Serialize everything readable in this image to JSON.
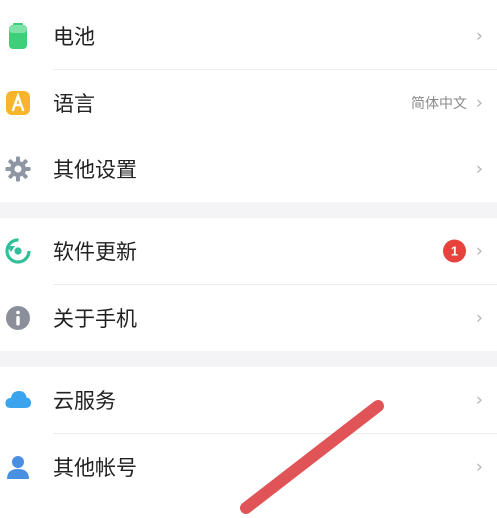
{
  "settings": {
    "group1": [
      {
        "label": "电池",
        "icon": "battery-icon"
      },
      {
        "label": "语言",
        "icon": "language-icon",
        "value": "简体中文"
      },
      {
        "label": "其他设置",
        "icon": "gear-icon"
      }
    ],
    "group2": [
      {
        "label": "软件更新",
        "icon": "update-icon",
        "badge": "1"
      },
      {
        "label": "关于手机",
        "icon": "info-icon"
      }
    ],
    "group3": [
      {
        "label": "云服务",
        "icon": "cloud-icon"
      },
      {
        "label": "其他帐号",
        "icon": "user-icon"
      }
    ]
  },
  "chevron": "›",
  "colors": {
    "battery": "#3fcf7a",
    "language": "#f7b52c",
    "gear": "#8e95a3",
    "update": "#2fbf9a",
    "info": "#8a8f9a",
    "cloud": "#3aa4ef",
    "user": "#4a90e2",
    "badge": "#e8423d",
    "stroke": "#e05458"
  }
}
